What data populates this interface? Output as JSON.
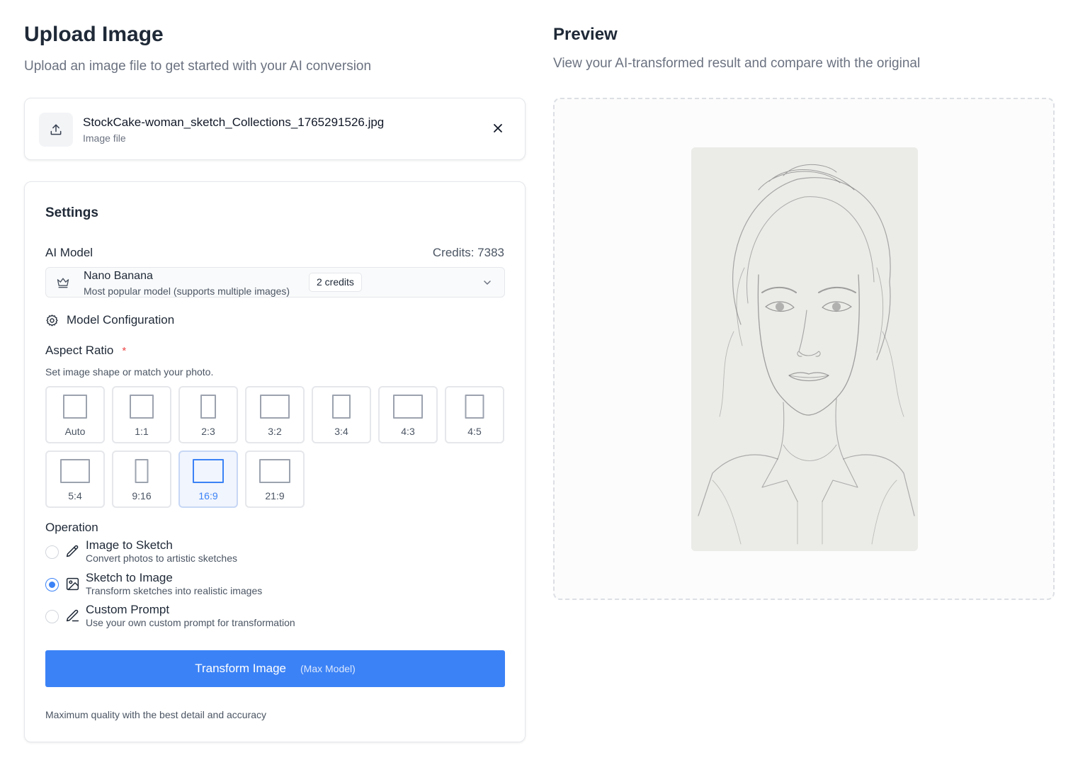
{
  "upload": {
    "title": "Upload Image",
    "subtitle": "Upload an image file to get started with your AI conversion",
    "file": {
      "name": "StockCake-woman_sketch_Collections_1765291526.jpg",
      "type": "Image file",
      "icon": "upload-icon",
      "close_icon": "close-icon"
    }
  },
  "settings": {
    "title": "Settings",
    "ai_model_label": "AI Model",
    "credits": "Credits: 7383",
    "model": {
      "name": "Nano Banana",
      "description": "Most popular model (supports multiple images)",
      "badge": "2 credits",
      "icon": "crown-icon"
    },
    "model_config_label": "Model Configuration",
    "aspect_ratio": {
      "label": "Aspect Ratio",
      "required_mark": "*",
      "help": "Set image shape or match your photo.",
      "selected": "16:9",
      "options": [
        "Auto",
        "1:1",
        "2:3",
        "3:2",
        "3:4",
        "4:3",
        "4:5",
        "5:4",
        "9:16",
        "16:9",
        "21:9"
      ]
    },
    "operation": {
      "label": "Operation",
      "selected": "Sketch to Image",
      "options": [
        {
          "title": "Image to Sketch",
          "desc": "Convert photos to artistic sketches",
          "icon": "pencil-icon"
        },
        {
          "title": "Sketch to Image",
          "desc": "Transform sketches into realistic images",
          "icon": "image-icon"
        },
        {
          "title": "Custom Prompt",
          "desc": "Use your own custom prompt for transformation",
          "icon": "pen-line-icon"
        }
      ]
    },
    "transform_button": {
      "label": "Transform Image",
      "sub": "(Max Model)"
    },
    "quality_note": "Maximum quality with the best detail and accuracy"
  },
  "preview": {
    "title": "Preview",
    "subtitle": "View your AI-transformed result and compare with the original",
    "image": "pencil sketch portrait of a woman"
  },
  "colors": {
    "accent": "#3b82f6",
    "required": "#ef4444",
    "text": "#1f2937",
    "muted": "#6b7280"
  }
}
